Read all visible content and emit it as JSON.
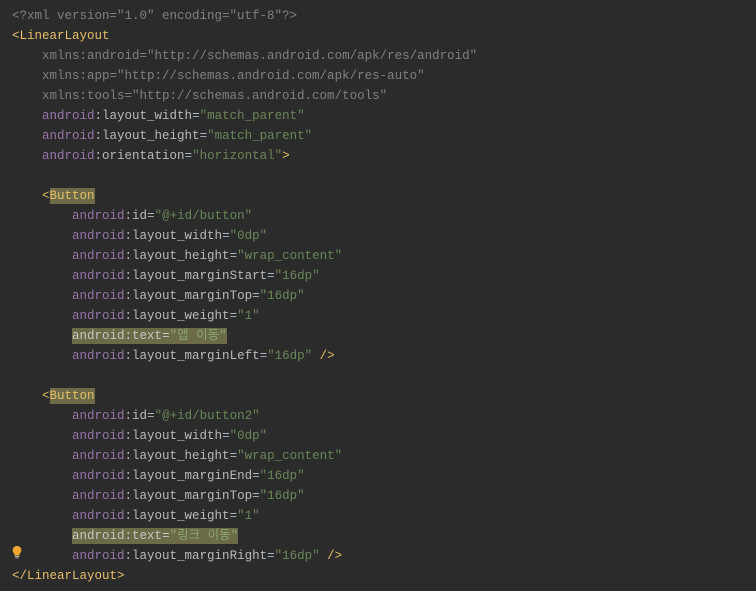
{
  "xml_decl": "<?xml version=\"1.0\" encoding=\"utf-8\"?>",
  "gutter_bulb": "lightbulb-icon",
  "root": {
    "open": "<",
    "tag": "LinearLayout",
    "close_open": ">",
    "close": "</",
    "end_tag": "LinearLayout",
    "end_close": ">"
  },
  "root_attrs": [
    {
      "ns": "xmlns",
      "name": "android",
      "val": "\"http://schemas.android.com/apk/res/android\"",
      "dim": true
    },
    {
      "ns": "xmlns",
      "name": "app",
      "val": "\"http://schemas.android.com/apk/res-auto\"",
      "dim": true
    },
    {
      "ns": "xmlns",
      "name": "tools",
      "val": "\"http://schemas.android.com/tools\"",
      "dim": true
    },
    {
      "ns": "android",
      "name": "layout_width",
      "val": "\"match_parent\"",
      "dim": false
    },
    {
      "ns": "android",
      "name": "layout_height",
      "val": "\"match_parent\"",
      "dim": false
    },
    {
      "ns": "android",
      "name": "orientation",
      "val": "\"horizontal\"",
      "dim": false,
      "close": ">"
    }
  ],
  "btn1": {
    "open": "<",
    "tag": "Button"
  },
  "btn1_attrs": [
    {
      "ns": "android",
      "name": "id",
      "val": "\"@+id/button\""
    },
    {
      "ns": "android",
      "name": "layout_width",
      "val": "\"0dp\""
    },
    {
      "ns": "android",
      "name": "layout_height",
      "val": "\"wrap_content\""
    },
    {
      "ns": "android",
      "name": "layout_marginStart",
      "val": "\"16dp\""
    },
    {
      "ns": "android",
      "name": "layout_marginTop",
      "val": "\"16dp\""
    },
    {
      "ns": "android",
      "name": "layout_weight",
      "val": "\"1\""
    },
    {
      "ns": "android",
      "name": "text",
      "val": "\"앱 이동\"",
      "hl": true
    },
    {
      "ns": "android",
      "name": "layout_marginLeft",
      "val": "\"16dp\"",
      "close": " />"
    }
  ],
  "btn2": {
    "open": "<",
    "tag": "Button"
  },
  "btn2_attrs": [
    {
      "ns": "android",
      "name": "id",
      "val": "\"@+id/button2\""
    },
    {
      "ns": "android",
      "name": "layout_width",
      "val": "\"0dp\""
    },
    {
      "ns": "android",
      "name": "layout_height",
      "val": "\"wrap_content\""
    },
    {
      "ns": "android",
      "name": "layout_marginEnd",
      "val": "\"16dp\""
    },
    {
      "ns": "android",
      "name": "layout_marginTop",
      "val": "\"16dp\""
    },
    {
      "ns": "android",
      "name": "layout_weight",
      "val": "\"1\""
    },
    {
      "ns": "android",
      "name": "text",
      "val": "\"링크 이동\"",
      "hl": true
    },
    {
      "ns": "android",
      "name": "layout_marginRight",
      "val": "\"16dp\"",
      "close": " />"
    }
  ]
}
